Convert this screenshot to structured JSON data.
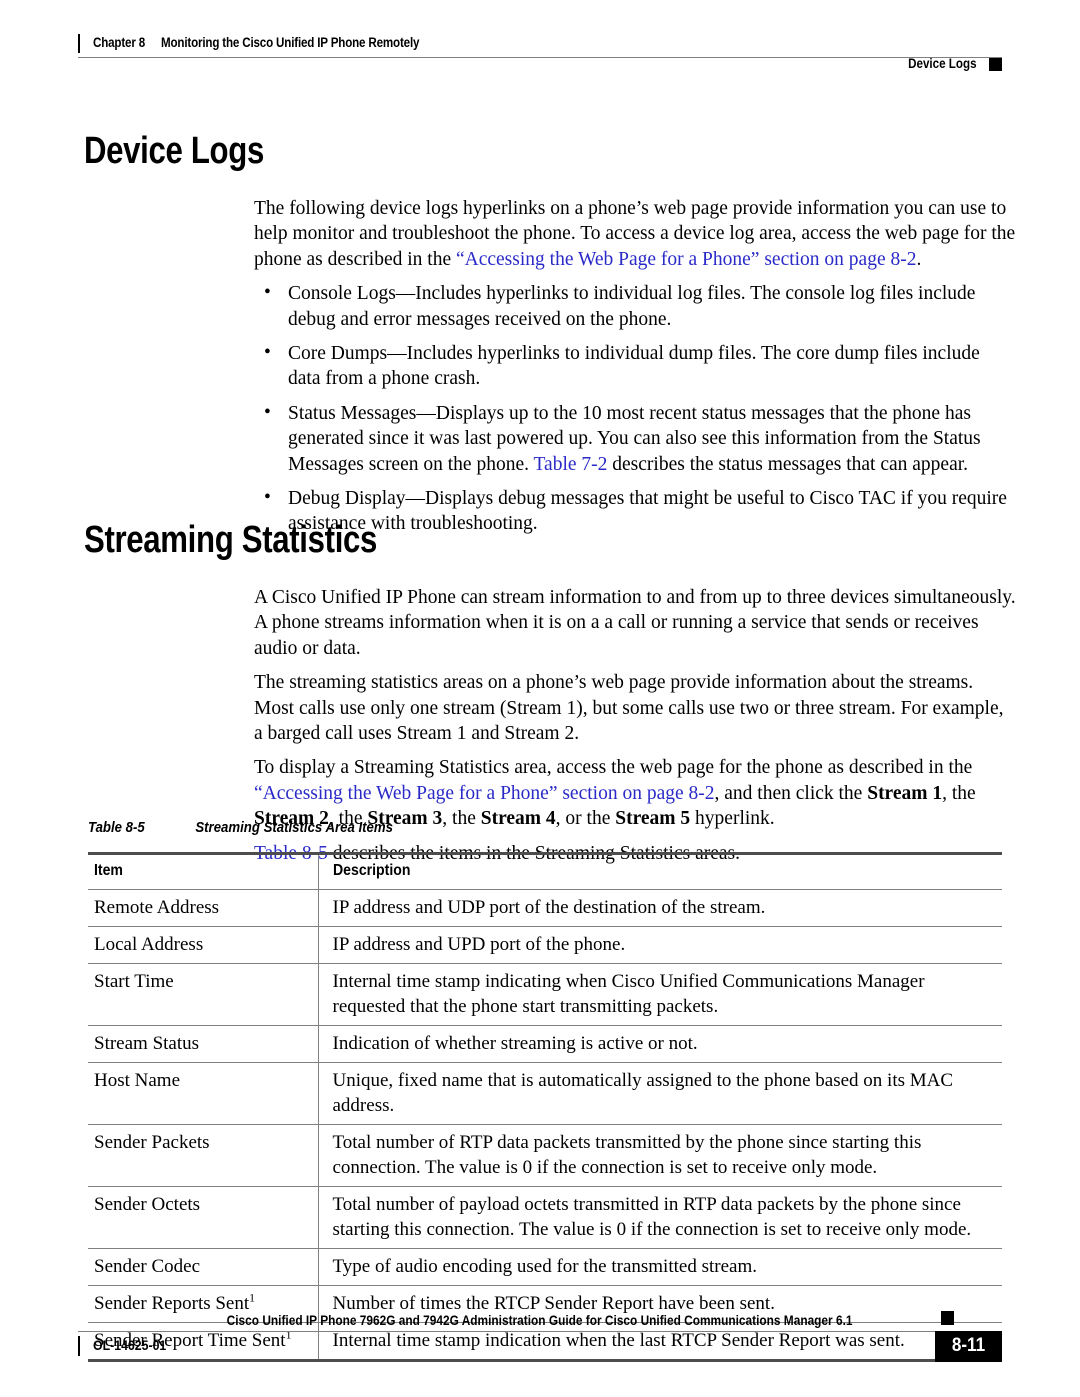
{
  "header": {
    "chapter_label": "Chapter 8",
    "chapter_title": "Monitoring the Cisco Unified IP Phone Remotely",
    "section_marker": "Device Logs"
  },
  "sections": {
    "device_logs": {
      "heading": "Device Logs",
      "intro_part1": "The following device logs hyperlinks on a phone’s web page provide information you can use to help monitor and troubleshoot the phone. To access a device log area, access the web page for the phone as described in the ",
      "intro_link": "“Accessing the Web Page for a Phone” section on page 8-2",
      "intro_part2": ".",
      "bullet_glyph": "•",
      "bullets": [
        {
          "text": "Console Logs—Includes hyperlinks to individual log files. The console log files include debug and error messages received on the phone."
        },
        {
          "text": "Core Dumps—Includes hyperlinks to individual dump files. The core dump files include data from a phone crash."
        },
        {
          "text_before": "Status Messages—Displays up to the 10 most recent status messages that the phone has generated since it was last powered up. You can also see this information from the Status Messages screen on the phone. ",
          "link": "Table 7-2",
          "text_after": " describes the status messages that can appear."
        },
        {
          "text": "Debug Display—Displays debug messages that might be useful to Cisco TAC if you require assistance with troubleshooting."
        }
      ]
    },
    "streaming_statistics": {
      "heading": "Streaming Statistics",
      "para1": "A Cisco Unified IP Phone can stream information to and from up to three devices simultaneously. A phone streams information when it is on a a call or running a service that sends or receives audio or data.",
      "para2": "The streaming statistics areas on a phone’s web page provide information about the streams. Most calls use only one stream (Stream 1), but some calls use two or three stream. For example, a barged call uses Stream 1 and Stream 2.",
      "para3_a": "To display a Streaming Statistics area, access the web page for the phone as described in the ",
      "para3_link": "“Accessing the Web Page for a Phone” section on page 8-2",
      "para3_b": ", and then click the ",
      "para3_s1": "Stream 1",
      "para3_c": ", the ",
      "para3_s2": "Stream 2",
      "para3_d": ", the ",
      "para3_s3": "Stream 3",
      "para3_e": ", the ",
      "para3_s4": "Stream 4",
      "para3_f": ", or the ",
      "para3_s5": "Stream 5",
      "para3_g": " hyperlink.",
      "para4_link": "Table 8-5",
      "para4_text": " describes the items in the Streaming Statistics areas."
    }
  },
  "table": {
    "caption_number": "Table 8-5",
    "caption_title": "Streaming Statistics Area Items",
    "columns": [
      "Item",
      "Description"
    ],
    "rows": [
      {
        "item": "Remote Address",
        "footnote": "",
        "description": "IP address and UDP port of the destination of the stream."
      },
      {
        "item": "Local Address",
        "footnote": "",
        "description": "IP address and UPD port of the phone."
      },
      {
        "item": "Start Time",
        "footnote": "",
        "description": "Internal time stamp indicating when Cisco Unified Communications Manager requested that the phone start transmitting packets."
      },
      {
        "item": "Stream Status",
        "footnote": "",
        "description": "Indication of whether streaming is active or not."
      },
      {
        "item": "Host Name",
        "footnote": "",
        "description": "Unique, fixed name that is automatically assigned to the phone based on its MAC address."
      },
      {
        "item": "Sender Packets",
        "footnote": "",
        "description": "Total number of RTP data packets transmitted by the phone since starting this connection. The value is 0 if the connection is set to receive only mode."
      },
      {
        "item": "Sender Octets",
        "footnote": "",
        "description": "Total number of payload octets transmitted in RTP data packets by the phone since starting this connection. The value is 0 if the connection is set to receive only mode."
      },
      {
        "item": "Sender Codec",
        "footnote": "",
        "description": "Type of audio encoding used for the transmitted stream."
      },
      {
        "item": "Sender Reports Sent",
        "footnote": "1",
        "description": "Number of times the RTCP Sender Report have been sent."
      },
      {
        "item": "Sender Report Time Sent",
        "footnote": "1",
        "description": "Internal time stamp indication when the last RTCP Sender Report was sent."
      }
    ]
  },
  "footer": {
    "guide_title": "Cisco Unified IP Phone 7962G and 7942G Administration Guide for Cisco Unified Communications Manager 6.1",
    "doc_id": "OL-14625-01",
    "page_number": "8-11"
  },
  "colors": {
    "link": "#2a2ac8",
    "rule": "#808080",
    "heavy_rule": "#4d4d4d",
    "text": "#000000"
  }
}
